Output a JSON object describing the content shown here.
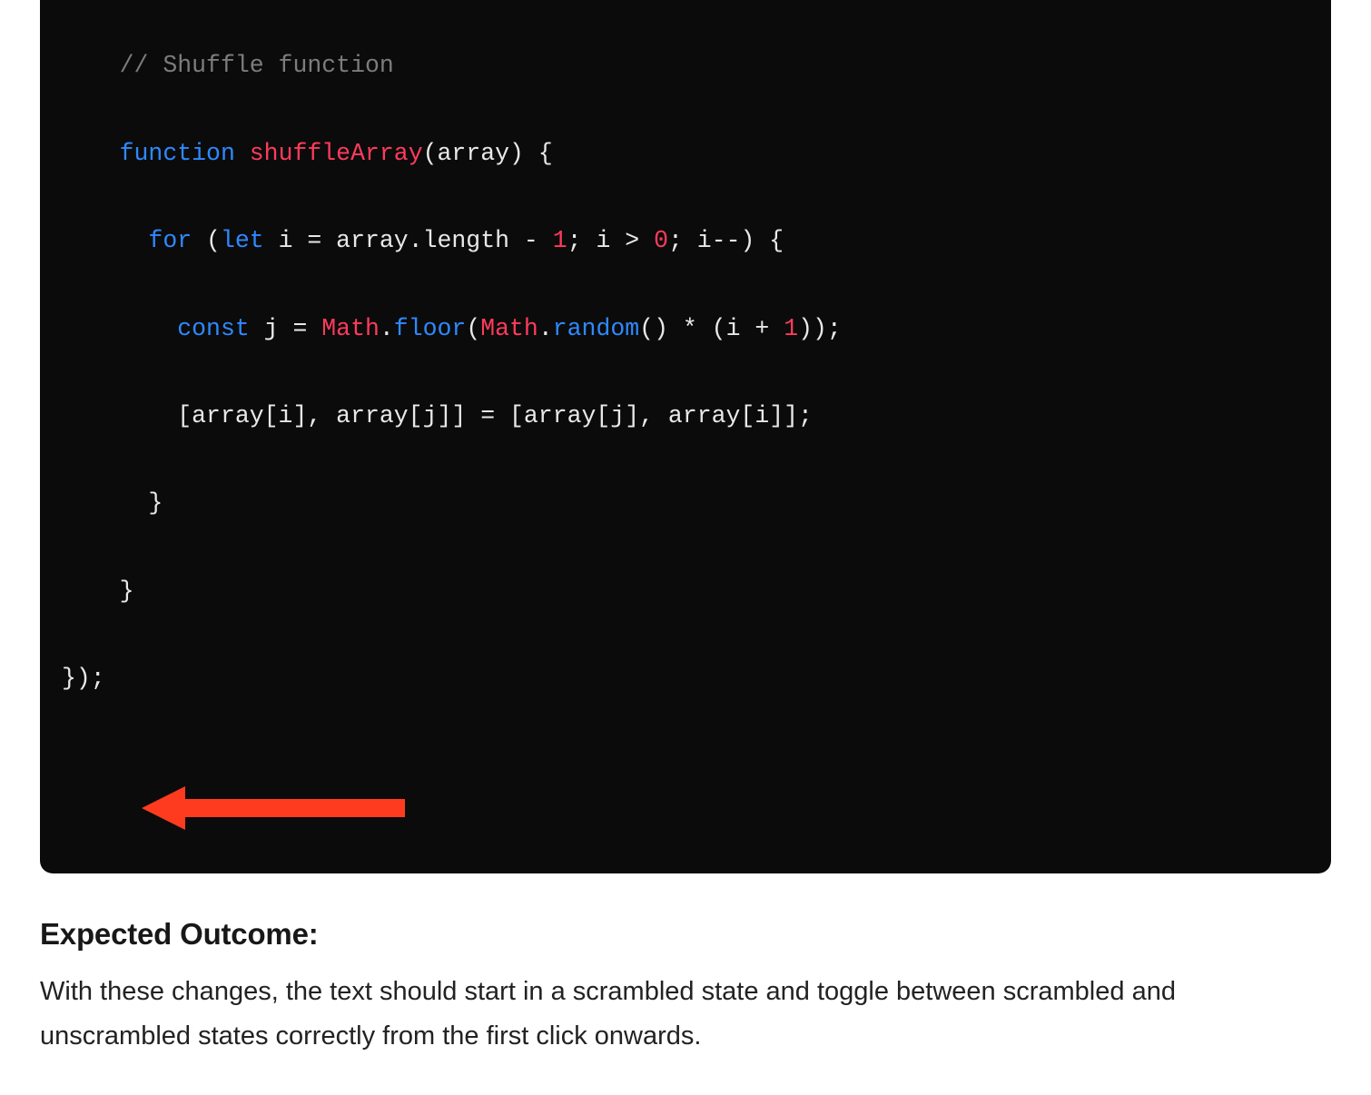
{
  "code": {
    "indent1": "    ",
    "indent2": "      ",
    "indent3": "        ",
    "comment": "// Shuffle function",
    "fn_kw": "function",
    "fn_name": "shuffleArray",
    "fn_params_open": "(array) {",
    "for_kw": "for",
    "for_open": " (",
    "let_kw": "let",
    "for_init": " i = array.length - ",
    "one_a": "1",
    "for_cond": "; i > ",
    "zero": "0",
    "for_step": "; i--) {",
    "const_kw": "const",
    "j_eq": " j = ",
    "math": "Math",
    "dot1": ".",
    "floor": "floor",
    "paren_open1": "(",
    "math2": "Math",
    "dot2": ".",
    "random": "random",
    "rand_tail": "() * (i + ",
    "one_b": "1",
    "rand_close": "));",
    "swap_line": "[array[i], array[j]] = [array[j], array[i]];",
    "close_brace1": "}",
    "close_brace2": "}",
    "close_final": "});"
  },
  "heading": "Expected Outcome:",
  "paragraph": "With these changes, the text should start in a scrambled state and toggle between scrambled and unscrambled states correctly from the first click onwards.",
  "annotation": {
    "color": "#ff3b1f"
  }
}
